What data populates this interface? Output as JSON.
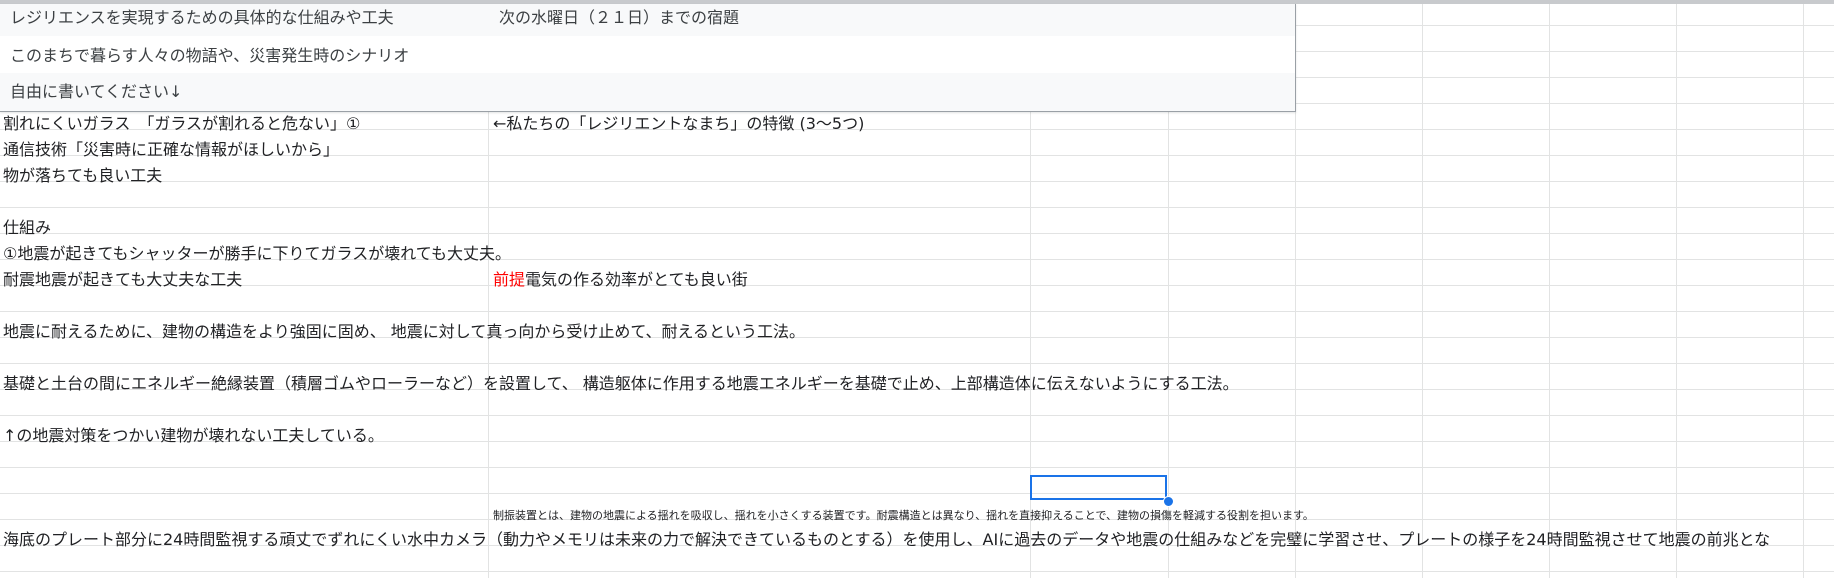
{
  "header_panel": {
    "row1_left": "レジリエンスを実現するための具体的な仕組みや工夫",
    "row1_right": "次の水曜日（２１日）までの宿題",
    "row2": "このまちで暮らす人々の物語や、災害発生時のシナリオ",
    "row3": "自由に書いてください↓"
  },
  "cells": {
    "r1_a": "割れにくいガラス　「ガラスが割れると危ない」①",
    "r1_b": "←私たちの「レジリエントなまち」の特徴 (3〜5つ)",
    "r2_a": "通信技術「災害時に正確な情報がほしいから」",
    "r3_a": "物が落ちても良い工夫",
    "r5_a": "仕組み",
    "r6_a": "①地震が起きてもシャッターが勝手に下りてガラスが壊れても大丈夫。",
    "r7_a": "耐震地震が起きても大丈夫な工夫",
    "r7_b_red": "前提",
    "r7_b": "電気の作る効率がとても良い街",
    "r9_a": "地震に耐えるために、建物の構造をより強固に固め、 地震に対して真っ向から受け止めて、耐えるという工法。",
    "r11_a": "基礎と土台の間にエネルギー絶縁装置（積層ゴムやローラーなど）を設置して、 構造躯体に作用する地震エネルギーを基礎で止め、上部構造体に伝えないようにする工法。",
    "r13_a": "↑の地震対策をつかい建物が壊れない工夫している。",
    "r16_b_small": "制振装置とは、建物の地震による揺れを吸収し、揺れを小さくする装置です。耐震構造とは異なり、揺れを直接抑えることで、建物の損傷を軽減する役割を担います。",
    "r17_a": "海底のプレート部分に24時間監視する頑丈でずれにくい水中カメラ（動力やメモリは未来の力で解決できているものとする）を使用し、AIに過去のデータや地震の仕組みなどを完璧に学習させ、プレートの様子を24時間監視させて地震の前兆とな"
  },
  "colors": {
    "selection": "#1a73e8",
    "gridline": "#e2e3e3",
    "emphasis_red": "#ff0000"
  }
}
